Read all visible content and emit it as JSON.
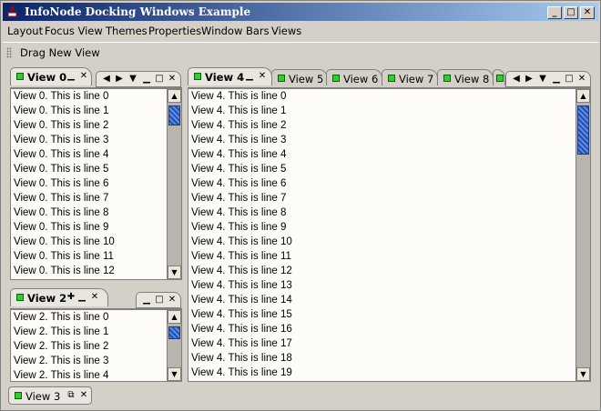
{
  "window": {
    "title": "InfoNode Docking Windows Example",
    "minimize_glyph": "_",
    "maximize_glyph": "□",
    "close_glyph": "✕"
  },
  "menubar": {
    "items": [
      "Layout",
      "Focus View",
      "Themes",
      "Properties",
      "Window Bars",
      "Views"
    ]
  },
  "toolbar": {
    "drag_label": "Drag New View"
  },
  "view0": {
    "tab_label": "View 0",
    "lines": [
      "View 0. This is line 0",
      "View 0. This is line 1",
      "View 0. This is line 2",
      "View 0. This is line 3",
      "View 0. This is line 4",
      "View 0. This is line 5",
      "View 0. This is line 6",
      "View 0. This is line 7",
      "View 0. This is line 8",
      "View 0. This is line 9",
      "View 0. This is line 10",
      "View 0. This is line 11",
      "View 0. This is line 12"
    ]
  },
  "view2": {
    "tab_label": "View 2",
    "lines": [
      "View 2. This is line 0",
      "View 2. This is line 1",
      "View 2. This is line 2",
      "View 2. This is line 3",
      "View 2. This is line 4"
    ]
  },
  "main_tabs": [
    "View 4",
    "View 5",
    "View 6",
    "View 7",
    "View 8"
  ],
  "view4": {
    "lines": [
      "View 4. This is line 0",
      "View 4. This is line 1",
      "View 4. This is line 2",
      "View 4. This is line 3",
      "View 4. This is line 4",
      "View 4. This is line 5",
      "View 4. This is line 6",
      "View 4. This is line 7",
      "View 4. This is line 8",
      "View 4. This is line 9",
      "View 4. This is line 10",
      "View 4. This is line 11",
      "View 4. This is line 12",
      "View 4. This is line 13",
      "View 4. This is line 14",
      "View 4. This is line 15",
      "View 4. This is line 16",
      "View 4. This is line 17",
      "View 4. This is line 18",
      "View 4. This is line 19"
    ]
  },
  "window_bar": {
    "minimized_label": "View 3"
  },
  "colors": {
    "title_start": "#0a246a",
    "title_end": "#a6caf0",
    "tab_indicator": "#33cc33",
    "scroll_thumb": "#3a6bc8"
  }
}
